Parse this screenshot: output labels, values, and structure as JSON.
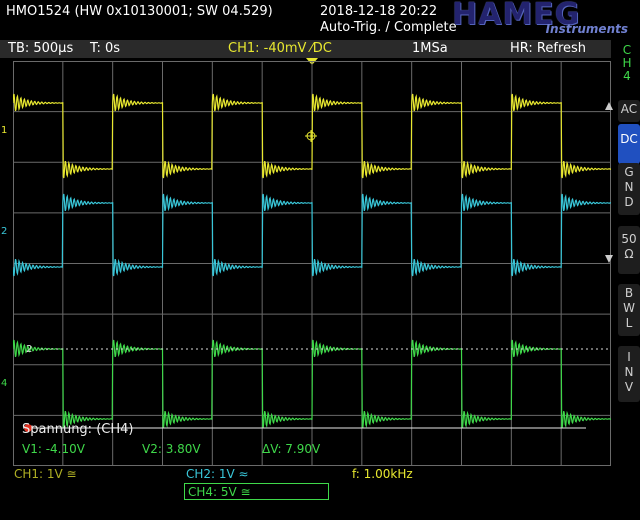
{
  "header": {
    "model": "HMO1524 (HW 0x10130001; SW 04.529)",
    "datetime": "2018-12-18 20:22",
    "trigger_state": "Auto-Trig. / Complete",
    "brand": "HAMEG",
    "brand_sub": "Instruments"
  },
  "status": {
    "timebase": "TB: 500µs",
    "time_offset": "T: 0s",
    "trigger": "CH1: -40mV ⁄DC",
    "sample_rate": "1MSa",
    "hr": "HR: Refresh"
  },
  "side_menu": {
    "channel": [
      "C",
      "H",
      "4"
    ],
    "buttons": [
      {
        "lines": [
          "AC"
        ],
        "active": false
      },
      {
        "lines": [
          "DC"
        ],
        "active": true
      },
      {
        "lines": [
          "G",
          "N",
          "D"
        ],
        "active": false
      },
      {
        "lines": [
          "50",
          "Ω"
        ],
        "active": false
      },
      {
        "lines": [
          "B",
          "W",
          "L"
        ],
        "active": false
      },
      {
        "lines": [
          "I",
          "N",
          "V"
        ],
        "active": false
      }
    ]
  },
  "measure": {
    "title": "Spannung: (CH4)",
    "v1": "V1: -4.10V",
    "v2": "V2: 3.80V",
    "dv": "ΔV: 7.90V"
  },
  "bottom": {
    "ch1": "CH1: 1V ≅",
    "ch2": "CH2: 1V ≈",
    "freq": "f: 1.00kHz",
    "ch4": "CH4: 5V ≅"
  },
  "markers": {
    "ch1": "1",
    "ch2": "2",
    "ch4": "4",
    "cursor2": "2"
  },
  "colors": {
    "ch1": "#e8e830",
    "ch2": "#39c6d8",
    "ch4": "#3fd84a",
    "grid": "#6a6a6a",
    "active_button": "#2050c0"
  }
}
